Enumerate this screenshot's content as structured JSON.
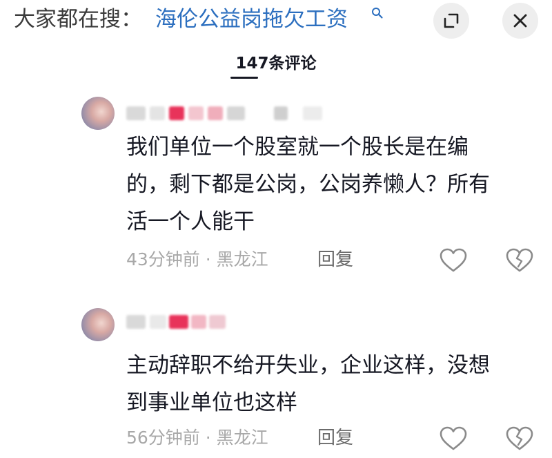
{
  "search_bar": {
    "prefix": "大家都在搜：",
    "term": "海伦公益岗拖欠工资",
    "term_icon": "search-icon",
    "expand_icon": "expand-icon",
    "close_icon": "close-icon"
  },
  "comments_header": {
    "count_label": "147条评论"
  },
  "comments": [
    {
      "avatar_icon": "avatar",
      "text": "我们单位一个股室就一个股长是在编\n的，剩下都是公岗，公岗养懒人？所有\n活一个人能干",
      "time": "43分钟前",
      "location": "黑龙江",
      "meta_separator": " · ",
      "reply_label": "回复",
      "like_icon": "heart-icon",
      "dislike_icon": "broken-heart-icon"
    },
    {
      "avatar_icon": "avatar",
      "text": "主动辞职不给开失业，企业这样，没想\n到事业单位也这样",
      "time": "56分钟前",
      "location": "黑龙江",
      "meta_separator": " · ",
      "reply_label": "回复",
      "like_icon": "heart-icon",
      "dislike_icon": "broken-heart-icon"
    }
  ],
  "colors": {
    "link_blue": "#2c6fbf",
    "text_primary": "#161823",
    "text_muted": "#a8a8a8",
    "button_bg": "#eeeeee",
    "blur_accent": "#e8335a"
  }
}
